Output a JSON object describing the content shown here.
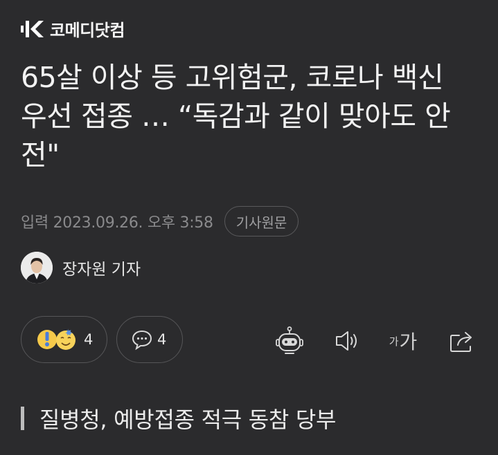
{
  "brand": {
    "name": "코메디닷컴"
  },
  "article": {
    "headline": "65살 이상 등 고위험군, 코로나 백신 우선 접종 … “독감과 같이 맞아도 안전\"",
    "published": "입력 2023.09.26. 오후 3:58",
    "original_label": "기사원문",
    "author": "장자원 기자",
    "subheading": "질병청, 예방접종 적극 동참 당부"
  },
  "actions": {
    "reaction_count": "4",
    "comment_count": "4",
    "font_label_small": "가",
    "font_label_large": "가"
  },
  "icons": {
    "reaction": [
      "surprised-emoji-icon",
      "smile-emoji-icon"
    ],
    "comment": "comment-icon",
    "summary": "robot-icon",
    "tts": "speaker-icon",
    "font": "font-size-icon",
    "share": "share-icon"
  },
  "colors": {
    "background": "#2b2b2d",
    "text": "#ececec",
    "muted": "#8a8a8c",
    "emoji_yellow": "#f5c94a",
    "emoji_blue": "#5b8fe0"
  }
}
